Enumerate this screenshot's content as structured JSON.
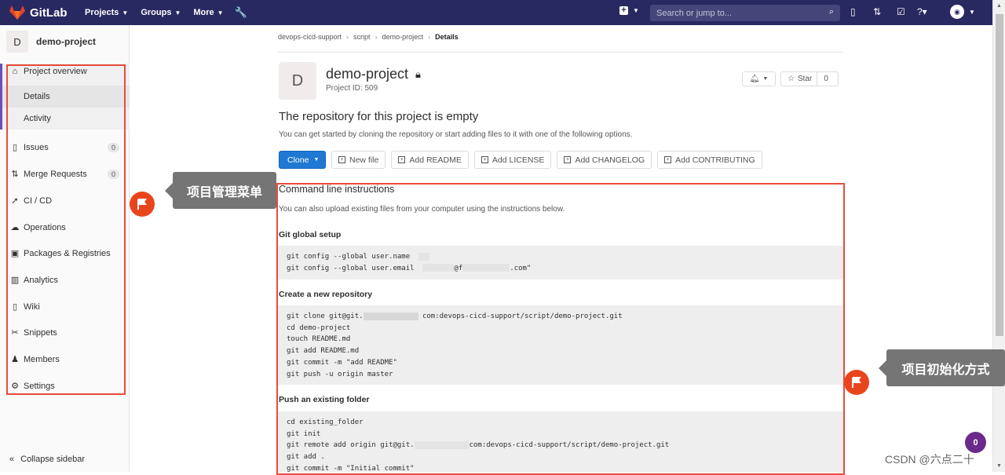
{
  "topbar": {
    "brand": "GitLab",
    "menus": [
      "Projects",
      "Groups",
      "More"
    ],
    "search_placeholder": "Search or jump to..."
  },
  "sidebar": {
    "avatar_letter": "D",
    "project_name": "demo-project",
    "overview": "Project overview",
    "sub": [
      "Details",
      "Activity"
    ],
    "items": [
      {
        "label": "Issues",
        "count": "0",
        "icon": "issues-icon"
      },
      {
        "label": "Merge Requests",
        "count": "0",
        "icon": "merge-request-icon"
      },
      {
        "label": "CI / CD",
        "icon": "rocket-icon"
      },
      {
        "label": "Operations",
        "icon": "cloud-icon"
      },
      {
        "label": "Packages & Registries",
        "icon": "package-icon"
      },
      {
        "label": "Analytics",
        "icon": "chart-icon"
      },
      {
        "label": "Wiki",
        "icon": "book-icon"
      },
      {
        "label": "Snippets",
        "icon": "scissors-icon"
      },
      {
        "label": "Members",
        "icon": "users-icon"
      },
      {
        "label": "Settings",
        "icon": "gear-icon"
      }
    ],
    "collapse": "Collapse sidebar"
  },
  "breadcrumb": [
    "devops-cicd-support",
    "script",
    "demo-project",
    "Details"
  ],
  "project": {
    "avatar_letter": "D",
    "title": "demo-project",
    "id_text": "Project ID: 509",
    "star_label": "Star",
    "star_count": "0"
  },
  "empty": {
    "heading": "The repository for this project is empty",
    "subtitle": "You can get started by cloning the repository or start adding files to it with one of the following options."
  },
  "buttons": {
    "clone": "Clone",
    "new_file": "New file",
    "readme": "Add README",
    "license": "Add LICENSE",
    "changelog": "Add CHANGELOG",
    "contributing": "Add CONTRIBUTING"
  },
  "cli": {
    "heading": "Command line instructions",
    "subtitle": "You can also upload existing files from your computer using the instructions below.",
    "global_title": "Git global setup",
    "global_l1": "git config --global user.name",
    "global_l2a": "git config --global user.email",
    "global_l2b": "@f",
    "global_l2c": ".com\"",
    "new_title": "Create a new repository",
    "new_l1a": "git clone git@git.",
    "new_l1b": "com:devops-cicd-support/script/demo-project.git",
    "new_l2": "cd demo-project",
    "new_l3": "touch README.md",
    "new_l4": "git add README.md",
    "new_l5": "git commit -m \"add README\"",
    "new_l6": "git push -u origin master",
    "push_title": "Push an existing folder",
    "push_l1": "cd existing_folder",
    "push_l2": "git init",
    "push_l3a": "git remote add origin git@git.",
    "push_l3b": "com:devops-cicd-support/script/demo-project.git",
    "push_l4": "git add .",
    "push_l5": "git commit -m \"Initial commit\""
  },
  "annotations": {
    "menu_label": "项目管理菜单",
    "init_label": "项目初始化方式"
  },
  "widget_badge": "0",
  "watermark": "CSDN @六点二十",
  "colors": {
    "topbar": "#292961",
    "accent": "#1f78d1",
    "highlight": "#e74c3c",
    "active": "#6b4fbb"
  }
}
